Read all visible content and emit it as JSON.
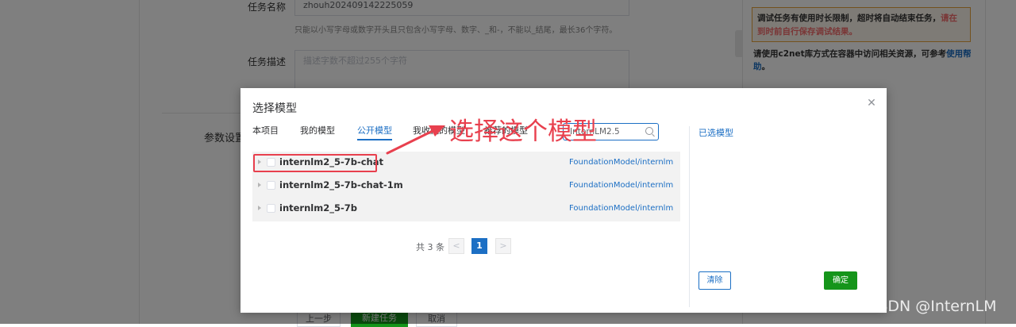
{
  "background": {
    "task_name_label": "任务名称",
    "task_name_value": "zhouh20240914222505​9",
    "task_name_hint": "只能以小写字母或数字开头且只包含小写字母、数字、_和-，不能以_结尾，最长36个字符。",
    "task_desc_label": "任务描述",
    "task_desc_placeholder": "描述字数不超过255个字符",
    "params_section": "参数设置",
    "warning_text": "调试任务有使用时长限制，超时将自动结束任务，",
    "warning_red": "请在到时前自行保存调试结果。",
    "help_text": "请使用c2net库方式在容器中访问相关资源，可参考",
    "help_link": "使用帮助",
    "help_tail": "。",
    "prev_button": "上一步",
    "create_button": "新建任务",
    "cancel_button": "取消"
  },
  "dialog": {
    "title": "选择模型",
    "tabs": [
      "本项目",
      "我的模型",
      "公开模型",
      "我收藏的模型",
      "推荐的模型"
    ],
    "active_tab": "公开模型",
    "search_value": "InternLM2.5",
    "selected_label": "已选模型",
    "models": [
      {
        "name": "internlm2_5-7b-chat",
        "repo": "FoundationModel/internlm"
      },
      {
        "name": "internlm2_5-7b-chat-1m",
        "repo": "FoundationModel/internlm"
      },
      {
        "name": "internlm2_5-7b",
        "repo": "FoundationModel/internlm"
      }
    ],
    "pagination": {
      "total_text": "共 3 条",
      "prev": "<",
      "current": "1",
      "next": ">"
    },
    "clear_button": "清除",
    "confirm_button": "确定"
  },
  "annotation": {
    "text": "选择这个模型",
    "color": "#e8404e"
  },
  "watermark": "CSDN @InternLM",
  "colors": {
    "accent": "#1c6fc4",
    "confirm": "#15951a",
    "annotation": "#e8404e"
  }
}
